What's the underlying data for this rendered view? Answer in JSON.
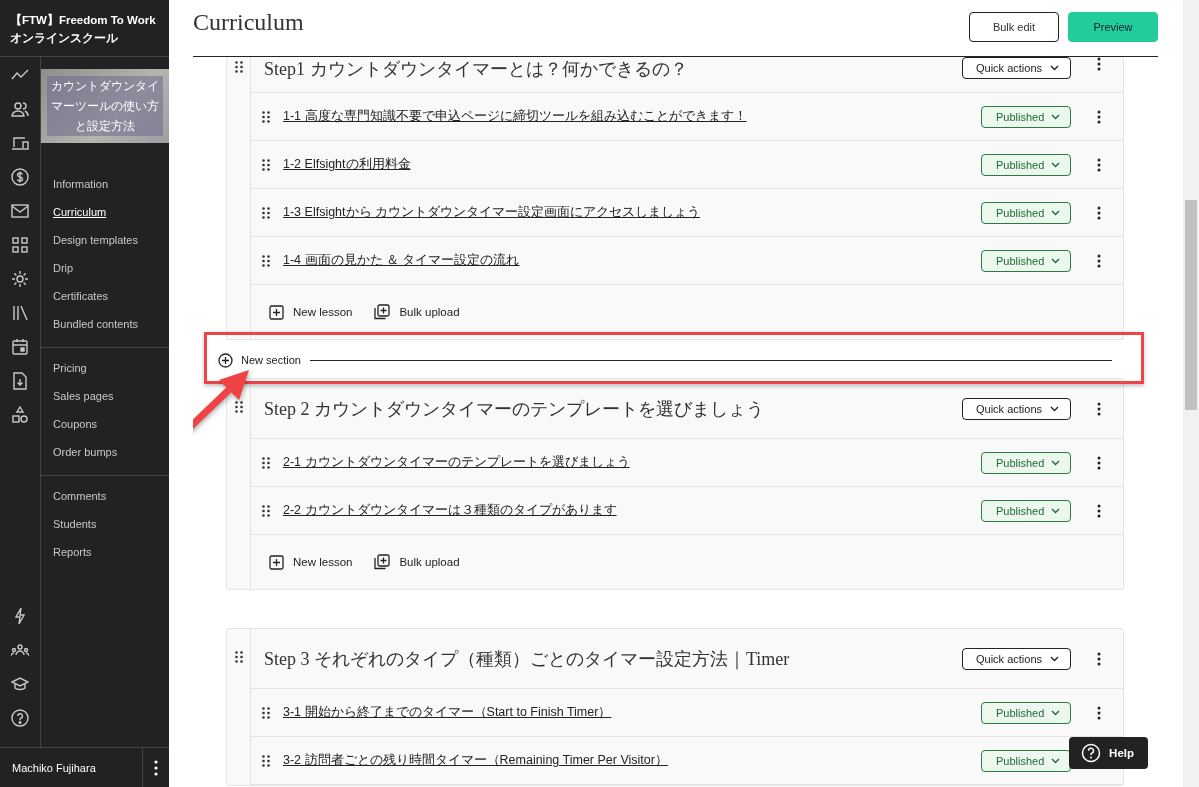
{
  "brand": {
    "line_1": "【FTW】Freedom To Work",
    "line_2": "オンラインスクール"
  },
  "course": {
    "thumbnail_title": "カウントダウンタイマーツールの使い方と設定方法"
  },
  "nav_groups": [
    [
      {
        "label": "Information",
        "selected": false
      },
      {
        "label": "Curriculum",
        "selected": true
      },
      {
        "label": "Design templates",
        "selected": false
      },
      {
        "label": "Drip",
        "selected": false
      },
      {
        "label": "Certificates",
        "selected": false
      },
      {
        "label": "Bundled contents",
        "selected": false
      }
    ],
    [
      {
        "label": "Pricing",
        "selected": false
      },
      {
        "label": "Sales pages",
        "selected": false
      },
      {
        "label": "Coupons",
        "selected": false
      },
      {
        "label": "Order bumps",
        "selected": false
      }
    ],
    [
      {
        "label": "Comments",
        "selected": false
      },
      {
        "label": "Students",
        "selected": false
      },
      {
        "label": "Reports",
        "selected": false
      }
    ]
  ],
  "user": {
    "name": "Machiko Fujihara"
  },
  "page": {
    "title": "Curriculum"
  },
  "header_buttons": [
    {
      "label": "Bulk edit",
      "kind": "outline"
    },
    {
      "label": "Preview",
      "kind": "primary"
    }
  ],
  "sections": [
    {
      "title": "Step1 カウントダウンタイマーとは？何かできるの？",
      "quick_actions": "Quick actions",
      "lessons": [
        {
          "title": "1-1 高度な専門知識不要で申込ページに締切ツールを組み込むことができます！",
          "status": "Published",
          "published": true
        },
        {
          "title": "1-2 Elfsightの利用料金",
          "status": "Published",
          "published": true
        },
        {
          "title": "1-3 Elfsightから カウントダウンタイマー設定画面にアクセスしましょう",
          "status": "Published",
          "published": true
        },
        {
          "title": "1-4 画面の見かた ＆ タイマー設定の流れ",
          "status": "Published",
          "published": true
        }
      ],
      "footer_actions": [
        {
          "label": "New lesson",
          "kind": "new"
        },
        {
          "label": "Bulk upload",
          "kind": "upload"
        }
      ],
      "new_section_below": "New section"
    },
    {
      "title": "Step 2 カウントダウンタイマーのテンプレートを選びましょう",
      "quick_actions": "Quick actions",
      "lessons": [
        {
          "title": "2-1 カウントダウンタイマーのテンプレートを選びましょう",
          "status": "Published",
          "published": true
        },
        {
          "title": "2-2 カウントダウンタイマーは３種類のタイプがあります",
          "status": "Published",
          "published": true
        }
      ],
      "footer_actions": [
        {
          "label": "New lesson",
          "kind": "new"
        },
        {
          "label": "Bulk upload",
          "kind": "upload"
        }
      ]
    },
    {
      "title": "Step 3  それぞれのタイプ（種類）ごとのタイマー設定方法｜Timer",
      "quick_actions": "Quick actions",
      "lessons": [
        {
          "title": "3-1 開始から終了までのタイマー（Start to Finish Timer）",
          "status": "Published",
          "published": true
        },
        {
          "title": "3-2 訪問者ごとの残り時間タイマー（Remaining Timer Per Visitor）",
          "status": "Published",
          "published": true
        }
      ]
    }
  ],
  "help": {
    "label": "Help"
  }
}
